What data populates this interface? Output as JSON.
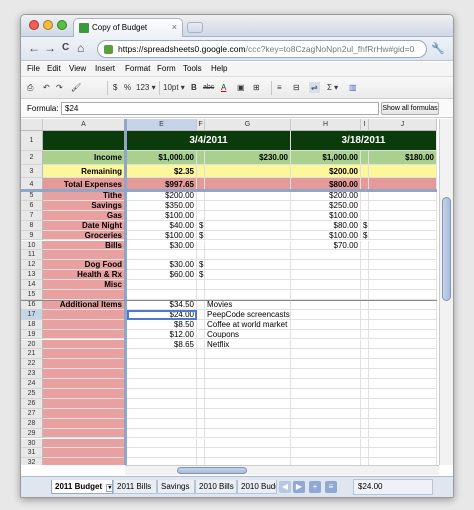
{
  "browser": {
    "tab_title": "Copy of Budget",
    "tab_close": "×",
    "url_host": "https://spreadsheets0.google.com",
    "url_rest": "/ccc?key=to8CzagNoNpn2ul_fhfRrHw#gid=0",
    "back": "←",
    "forward": "→",
    "reload": "C",
    "home": "⌂",
    "wrench": "🔧"
  },
  "menu": [
    "File",
    "Edit",
    "View",
    "Insert",
    "Format",
    "Form",
    "Tools",
    "Help"
  ],
  "toolbar": {
    "print": "⎙",
    "undo": "↶",
    "redo": "↷",
    "paint": "🖌",
    "currency": "$",
    "percent": "%",
    "numfmt": "123 ▾",
    "fontsize": "10pt ▾",
    "bold": "B",
    "strike": "abc",
    "textcolor": "A",
    "fillcolor": "▣",
    "borders": "⊞",
    "align": "≡",
    "merge": "⊟",
    "wrap": "⇌",
    "sum": "Σ ▾",
    "chart": "▥"
  },
  "formula": {
    "label": "Formula:",
    "value": "$24",
    "show_all": "Show all formulas"
  },
  "columns": [
    "A",
    "E",
    "F",
    "G",
    "H",
    "I",
    "J"
  ],
  "selected_cell": "E17",
  "rows": {
    "1": {
      "E": "3/4/2011",
      "H": "3/18/2011"
    },
    "2": {
      "A": "Income",
      "E": "$1,000.00",
      "G": "$230.00",
      "H": "$1,000.00",
      "J": "$180.00"
    },
    "3": {
      "A": "Remaining",
      "E": "$2.35",
      "H": "$200.00"
    },
    "4": {
      "A": "Total Expenses",
      "E": "$997.65",
      "H": "$800.00"
    },
    "5": {
      "A": "Tithe",
      "E": "$200.00",
      "H": "$200.00"
    },
    "6": {
      "A": "Savings",
      "E": "$350.00",
      "H": "$250.00"
    },
    "7": {
      "A": "Gas",
      "E": "$100.00",
      "H": "$100.00"
    },
    "8": {
      "A": "Date Night",
      "E": "$40.00",
      "F": "$",
      "H": "$80.00",
      "I": "$"
    },
    "9": {
      "A": "Groceries",
      "E": "$100.00",
      "F": "$",
      "H": "$100.00",
      "I": "$"
    },
    "10": {
      "A": "Bills",
      "E": "$30.00",
      "H": "$70.00"
    },
    "12": {
      "A": "Dog Food",
      "E": "$30.00",
      "F": "$"
    },
    "13": {
      "A": "Health & Rx",
      "E": "$60.00",
      "F": "$"
    },
    "14": {
      "A": "Misc"
    },
    "16": {
      "A": "Additional Items",
      "E": "$34.50",
      "G": "Movies"
    },
    "17": {
      "E": "$24.00",
      "G": "PeepCode screencasts"
    },
    "18": {
      "E": "$8.50",
      "G": "Coffee at world market"
    },
    "19": {
      "E": "$12.00",
      "G": "Coupons"
    },
    "20": {
      "E": "$8.65",
      "G": "Netflix"
    }
  },
  "sheets": [
    "2011 Budget",
    "2011 Bills",
    "Savings",
    "2010 Bills",
    "2010 Budg"
  ],
  "sheet_menu": "▾",
  "sheet_nav": [
    "◀",
    "▶",
    "+",
    "≡"
  ],
  "sum_display": "$24.00",
  "colors": {
    "dark_green": "#0b3a0b",
    "light_green": "#a9d08e",
    "yellow": "#fbf79a",
    "red": "#e59a9a",
    "pink": "#e8a0a0"
  }
}
